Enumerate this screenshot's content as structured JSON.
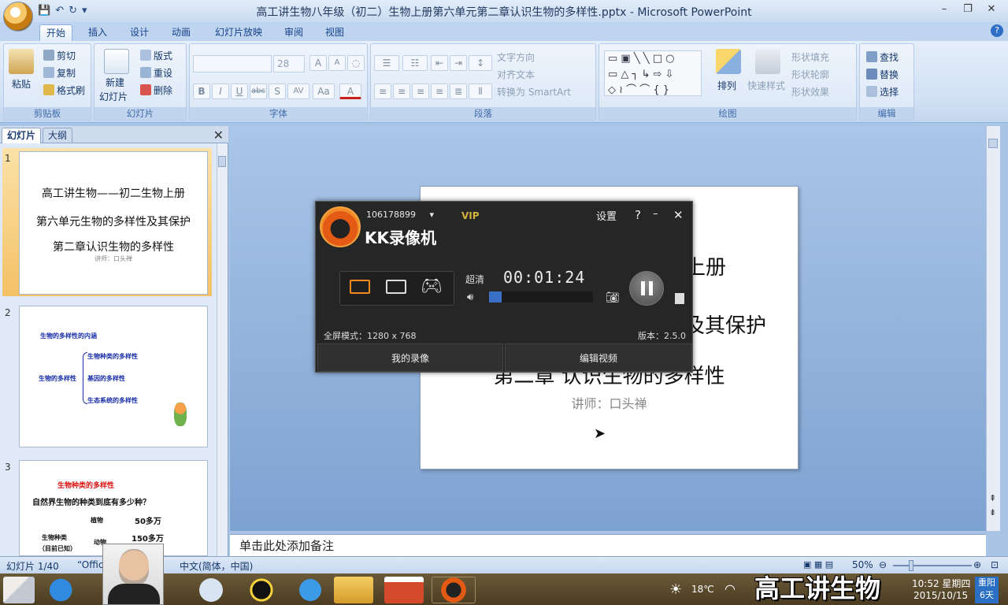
{
  "window": {
    "title": "高工讲生物八年级（初二）生物上册第六单元第二章认识生物的多样性.pptx - Microsoft PowerPoint",
    "min": "–",
    "max": "❐",
    "close": "✕"
  },
  "ribbon_tabs": [
    "开始",
    "插入",
    "设计",
    "动画",
    "幻灯片放映",
    "审阅",
    "视图"
  ],
  "clipboard": {
    "paste": "粘贴",
    "cut": "剪切",
    "copy": "复制",
    "format_painter": "格式刷",
    "label": "剪贴板"
  },
  "slides_group": {
    "new_slide": "新建",
    "new_slide2": "幻灯片",
    "layout": "版式",
    "reset": "重设",
    "delete": "删除",
    "label": "幻灯片"
  },
  "font_group": {
    "size": "28",
    "bold": "B",
    "italic": "I",
    "underline": "U",
    "strike": "abc",
    "shadow": "S",
    "spacing": "AV",
    "case": "Aa",
    "color": "A",
    "grow": "A",
    "shrink": "A",
    "label": "字体"
  },
  "paragraph_group": {
    "text_direction": "文字方向",
    "align_text": "对齐文本",
    "smartart": "转换为 SmartArt",
    "label": "段落"
  },
  "drawing_group": {
    "arrange": "排列",
    "quick_styles": "快速样式",
    "fill": "形状填充",
    "outline": "形状轮廓",
    "effects": "形状效果",
    "label": "绘图"
  },
  "editing_group": {
    "find": "查找",
    "replace": "替换",
    "select": "选择",
    "label": "编辑"
  },
  "panel_tabs": {
    "slides": "幻灯片",
    "outline": "大纲"
  },
  "thumbs": {
    "s1": {
      "num": "1",
      "l1": "高工讲生物——初二生物上册",
      "l2": "第六单元生物的多样性及其保护",
      "l3": "第二章认识生物的多样性",
      "l4": "讲师：口头禅"
    },
    "s2": {
      "num": "2",
      "head": "生物的多样性的内涵",
      "root": "生物的多样性",
      "b1": "生物种类的多样性",
      "b2": "基因的多样性",
      "b3": "生态系统的多样性"
    },
    "s3": {
      "num": "3",
      "head": "生物种类的多样性",
      "q": "自然界生物的种类到底有多少种？",
      "c1": "植物",
      "v1": "50多万",
      "c2": "动物",
      "v2": "150多万",
      "k1": "生物种类",
      "k2": "（目前已知）"
    }
  },
  "slide": {
    "l2": "物上册",
    "l3": "及其保护",
    "l4": "第二章 认识生物的多样性",
    "l5": "讲师：口头禅"
  },
  "notes": "单击此处添加备注",
  "status": {
    "slide": "幻灯片 1/40",
    "theme": "“Offic",
    "lang": "中文(简体，中国)",
    "zoom": "50%"
  },
  "recorder": {
    "account": "106178899",
    "vip": "VIP",
    "title": "KK录像机",
    "settings": "设置",
    "help": "?",
    "minimize": "–",
    "close": "✕",
    "quality": "超清",
    "time": "00:01:24",
    "volume_level": 0.12,
    "mode": "全屏模式：1280 x 768",
    "version": "版本：2.5.0",
    "my_recordings": "我的录像",
    "edit_video": "编辑视频"
  },
  "taskbar": {
    "temp": "18℃",
    "clock_time": "10:52 星期四",
    "clock_date": "2015/10/15",
    "weather1": "重阳",
    "weather2": "6天"
  },
  "overlay": "高工讲生物"
}
